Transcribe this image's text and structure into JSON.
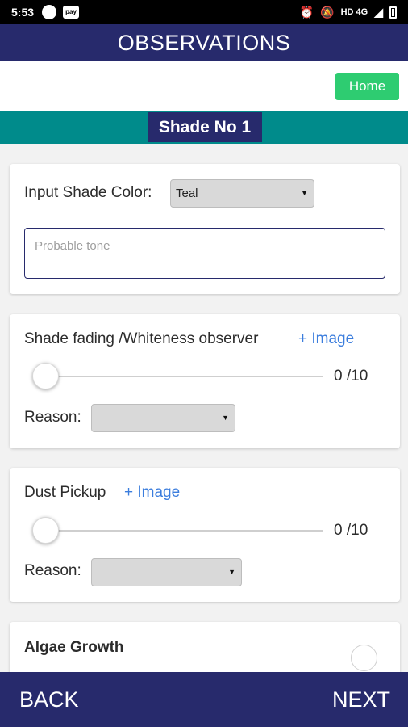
{
  "status_bar": {
    "time": "5:53",
    "pay_badge": "pay",
    "network_label": "HD 4G",
    "alarm_icon": "alarm-icon",
    "mute_icon": "notifications-off-icon",
    "battery_icon": "battery-icon"
  },
  "header": {
    "title": "OBSERVATIONS"
  },
  "toolbar": {
    "home_label": "Home"
  },
  "shade": {
    "title": "Shade No 1"
  },
  "shade_color": {
    "label": "Input Shade Color:",
    "selected": "Teal",
    "tone_placeholder": "Probable tone"
  },
  "fading": {
    "label": "Shade fading /Whiteness observer",
    "image_link": "+ Image",
    "slider_value": "0 /10",
    "slider_fraction": 0,
    "reason_label": "Reason:",
    "reason_selected": ""
  },
  "dust": {
    "label": "Dust Pickup",
    "image_link": "+ Image",
    "slider_value": "0 /10",
    "slider_fraction": 0,
    "reason_label": "Reason:",
    "reason_selected": ""
  },
  "algae": {
    "label": "Algae Growth"
  },
  "nav": {
    "back_label": "BACK",
    "next_label": "NEXT"
  },
  "colors": {
    "primary": "#272a6c",
    "accent_teal": "#008b8b",
    "home_green": "#2ecc71",
    "link_blue": "#3b7ddd"
  }
}
